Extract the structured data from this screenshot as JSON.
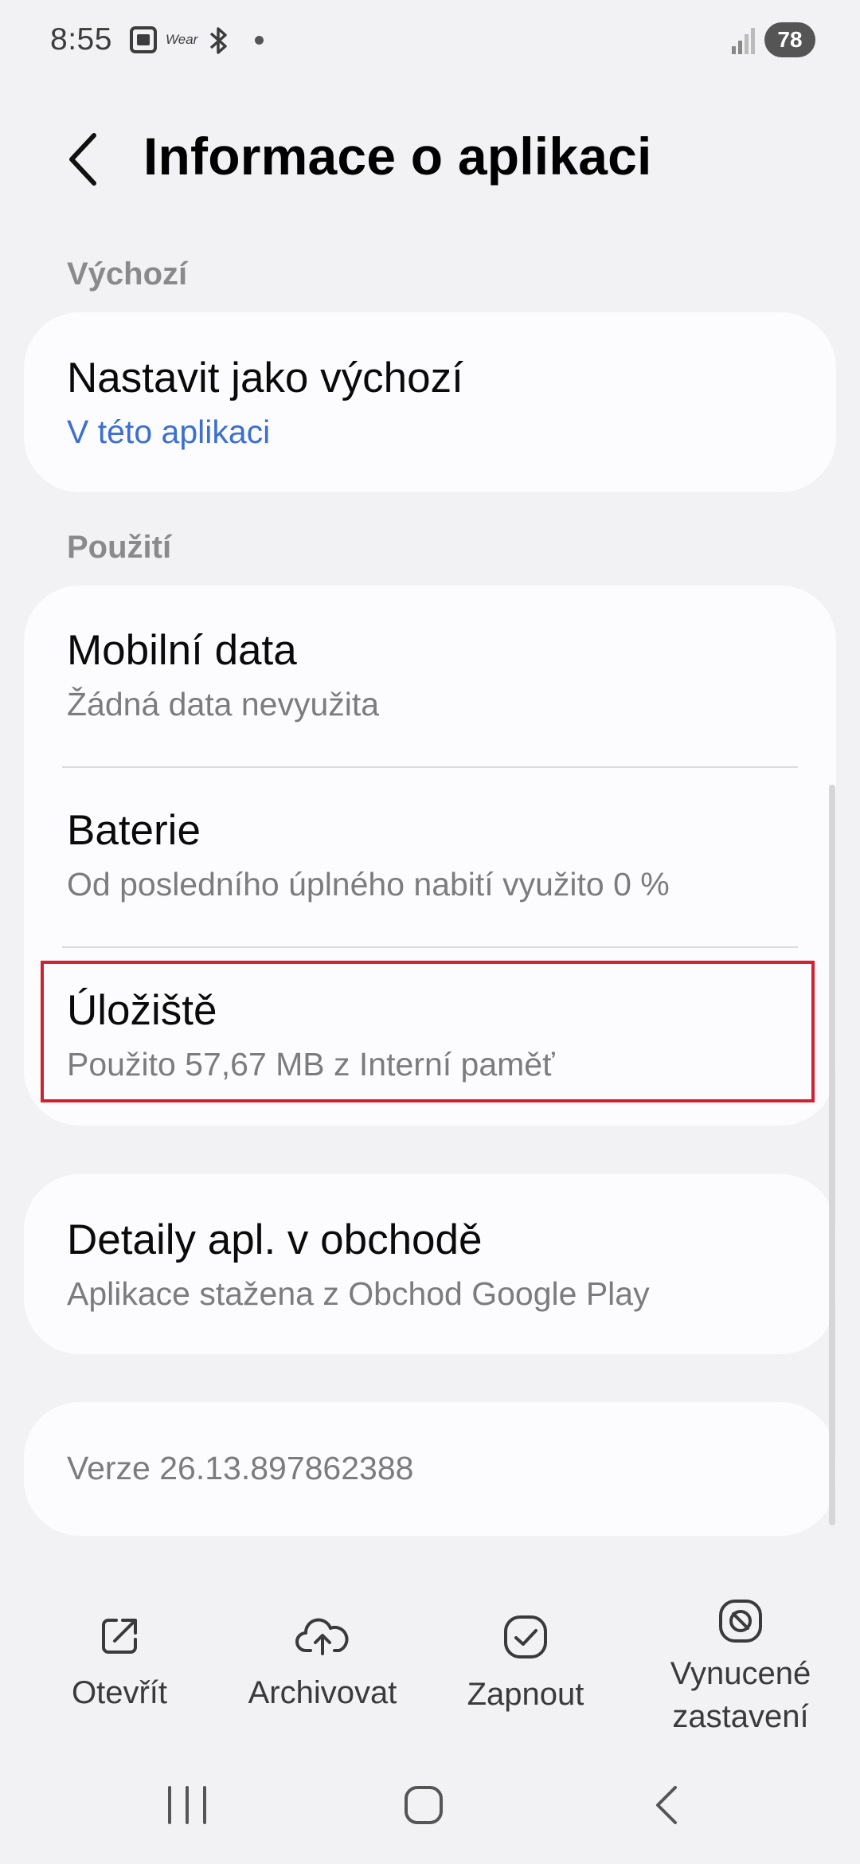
{
  "status_bar": {
    "time": "8:55",
    "wear_label": "Wear",
    "battery_level": "78",
    "icons": [
      "gallery-icon",
      "wear-icon",
      "bluetooth-icon",
      "notification-dot-icon",
      "signal-icon",
      "battery-icon"
    ]
  },
  "header": {
    "title": "Informace o aplikaci"
  },
  "sections": {
    "default_label": "Výchozí",
    "usage_label": "Použití"
  },
  "defaults": {
    "title": "Nastavit jako výchozí",
    "subtitle": "V této aplikaci"
  },
  "usage": {
    "mobile_data": {
      "title": "Mobilní data",
      "subtitle": "Žádná data nevyužita"
    },
    "battery": {
      "title": "Baterie",
      "subtitle": "Od posledního úplného nabití využito 0 %"
    },
    "storage": {
      "title": "Úložiště",
      "subtitle": "Použito 57,67 MB z Interní paměť"
    }
  },
  "store": {
    "title": "Detaily apl. v obchodě",
    "subtitle": "Aplikace stažena z Obchod Google Play"
  },
  "version": {
    "text": "Verze 26.13.897862388"
  },
  "actions": {
    "open": "Otevřít",
    "archive": "Archivovat",
    "enable": "Zapnout",
    "force_stop_line1": "Vynucené",
    "force_stop_line2": "zastavení"
  },
  "colors": {
    "background": "#f2f2f4",
    "card": "#fcfcfe",
    "link": "#3d6fd0",
    "highlight": "#d1202f"
  }
}
